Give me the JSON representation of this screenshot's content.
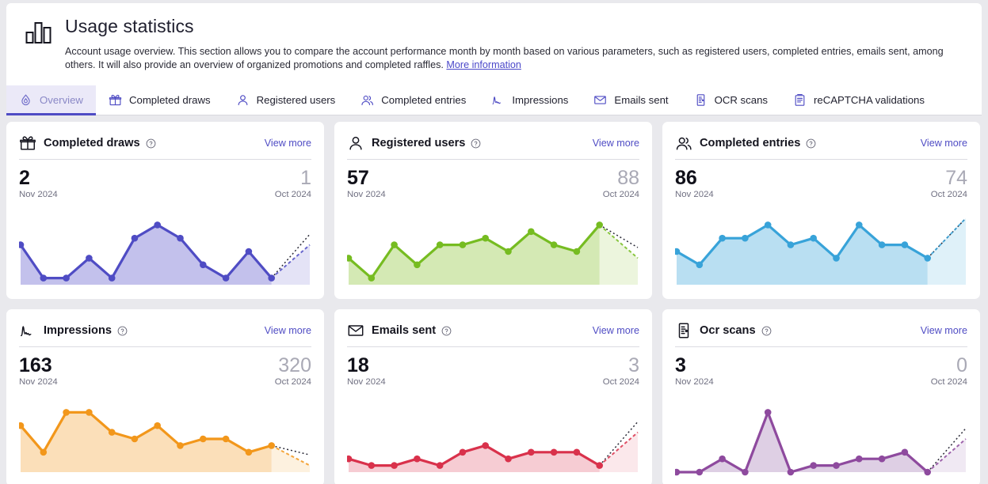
{
  "header": {
    "icon": "bar-chart-icon",
    "title": "Usage statistics",
    "description": "Account usage overview. This section allows you to compare the account performance month by month based on various parameters, such as registered users, completed entries, emails sent, among others. It will also provide an overview of organized promotions and completed raffles.",
    "more_link": "More information"
  },
  "tabs": [
    {
      "label": "Overview",
      "icon": "droplet-icon",
      "active": true
    },
    {
      "label": "Completed draws",
      "icon": "gift-icon",
      "active": false
    },
    {
      "label": "Registered users",
      "icon": "user-icon",
      "active": false
    },
    {
      "label": "Completed entries",
      "icon": "users-icon",
      "active": false
    },
    {
      "label": "Impressions",
      "icon": "spike-chart-icon",
      "active": false
    },
    {
      "label": "Emails sent",
      "icon": "envelope-icon",
      "active": false
    },
    {
      "label": "OCR scans",
      "icon": "ocr-document-icon",
      "active": false
    },
    {
      "label": "reCAPTCHA validations",
      "icon": "clipboard-icon",
      "active": false
    }
  ],
  "colors": {
    "accent": "#4f4cc4",
    "tab_active_bg": "#ebe9f8",
    "completed_draws": "#4f4cc4",
    "registered_users": "#76bc21",
    "completed_entries": "#38a3d9",
    "impressions": "#f2971b",
    "emails_sent": "#d9314b",
    "ocr_scans": "#8e4a9e"
  },
  "cards": [
    {
      "icon": "gift-icon",
      "title": "Completed draws",
      "help": "help-icon",
      "view_more": "View more",
      "current_value": "2",
      "current_label": "Nov 2024",
      "previous_value": "1",
      "previous_label": "Oct 2024",
      "chart_data": {
        "type": "area",
        "title": "Completed draws",
        "color": "#4f4cc4",
        "fill": "#c3c1ec",
        "ylim": [
          0,
          10
        ],
        "values": [
          6,
          1,
          1,
          4,
          1,
          7,
          9,
          7,
          3,
          1,
          5,
          1
        ],
        "forecast": [
          1,
          6
        ],
        "grid": false
      }
    },
    {
      "icon": "user-icon",
      "title": "Registered users",
      "help": "help-icon",
      "view_more": "View more",
      "current_value": "57",
      "current_label": "Nov 2024",
      "previous_value": "88",
      "previous_label": "Oct 2024",
      "chart_data": {
        "type": "area",
        "title": "Registered users",
        "color": "#76bc21",
        "fill": "#d4e9b4",
        "ylim": [
          0,
          10
        ],
        "values": [
          4,
          1,
          6,
          3,
          6,
          6,
          7,
          5,
          8,
          6,
          5,
          9
        ],
        "forecast": [
          9,
          4
        ],
        "grid": false
      }
    },
    {
      "icon": "users-icon",
      "title": "Completed entries",
      "help": "help-icon",
      "view_more": "View more",
      "current_value": "86",
      "current_label": "Nov 2024",
      "previous_value": "74",
      "previous_label": "Oct 2024",
      "chart_data": {
        "type": "area",
        "title": "Completed entries",
        "color": "#38a3d9",
        "fill": "#b9dff2",
        "ylim": [
          0,
          10
        ],
        "values": [
          5,
          3,
          7,
          7,
          9,
          6,
          7,
          4,
          9,
          6,
          6,
          4
        ],
        "forecast": [
          4,
          10
        ],
        "grid": false
      }
    },
    {
      "icon": "spike-chart-icon",
      "title": "Impressions",
      "help": "help-icon",
      "view_more": "View more",
      "current_value": "163",
      "current_label": "Nov 2024",
      "previous_value": "320",
      "previous_label": "Oct 2024",
      "chart_data": {
        "type": "area",
        "title": "Impressions",
        "color": "#f2971b",
        "fill": "#fbdfb9",
        "ylim": [
          0,
          10
        ],
        "values": [
          7,
          3,
          9,
          9,
          6,
          5,
          7,
          4,
          5,
          5,
          3,
          4
        ],
        "forecast": [
          4,
          1
        ],
        "grid": false
      }
    },
    {
      "icon": "envelope-icon",
      "title": "Emails sent",
      "help": "help-icon",
      "view_more": "View more",
      "current_value": "18",
      "current_label": "Nov 2024",
      "previous_value": "3",
      "previous_label": "Oct 2024",
      "chart_data": {
        "type": "area",
        "title": "Emails sent",
        "color": "#d9314b",
        "fill": "#f6ccd3",
        "ylim": [
          0,
          10
        ],
        "values": [
          2,
          1,
          1,
          2,
          1,
          3,
          4,
          2,
          3,
          3,
          3,
          1
        ],
        "forecast": [
          1,
          6
        ],
        "grid": false
      }
    },
    {
      "icon": "ocr-document-icon",
      "title": "Ocr scans",
      "help": "help-icon",
      "view_more": "View more",
      "current_value": "3",
      "current_label": "Nov 2024",
      "previous_value": "0",
      "previous_label": "Oct 2024",
      "chart_data": {
        "type": "area",
        "title": "Ocr scans",
        "color": "#8e4a9e",
        "fill": "#decfe4",
        "ylim": [
          0,
          10
        ],
        "values": [
          0,
          0,
          2,
          0,
          9,
          0,
          1,
          1,
          2,
          2,
          3,
          0
        ],
        "forecast": [
          0,
          5
        ],
        "grid": false
      }
    }
  ]
}
